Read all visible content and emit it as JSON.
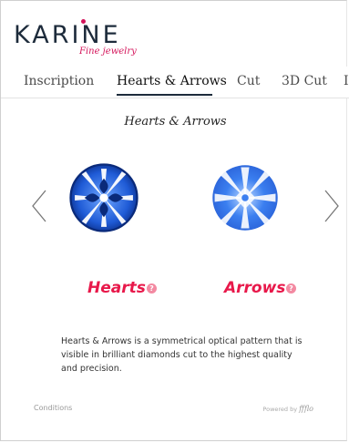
{
  "brand": {
    "name": "KARINE",
    "tagline": "Fine jewelry",
    "accent_color": "#d4145a"
  },
  "tabs": [
    {
      "label": "Inscription",
      "active": false
    },
    {
      "label": "Hearts & Arrows",
      "active": true
    },
    {
      "label": "Cut",
      "active": false
    },
    {
      "label": "3D Cut",
      "active": false
    },
    {
      "label": "I",
      "active": false
    }
  ],
  "main": {
    "title": "Hearts & Arrows",
    "prev_icon": "chevron-left-icon",
    "next_icon": "chevron-right-icon",
    "hearts": {
      "label": "Hearts",
      "help_icon": "question-icon",
      "color": "#e8184a"
    },
    "arrows": {
      "label": "Arrows",
      "help_icon": "question-icon",
      "color": "#e8184a"
    },
    "description": "Hearts & Arrows is a symmetrical optical pattern that is visible in brilliant diamonds cut to the highest quality and precision."
  },
  "footer": {
    "conditions_label": "Conditions",
    "powered_label": "Powered by",
    "powered_logo": "ffflo"
  }
}
